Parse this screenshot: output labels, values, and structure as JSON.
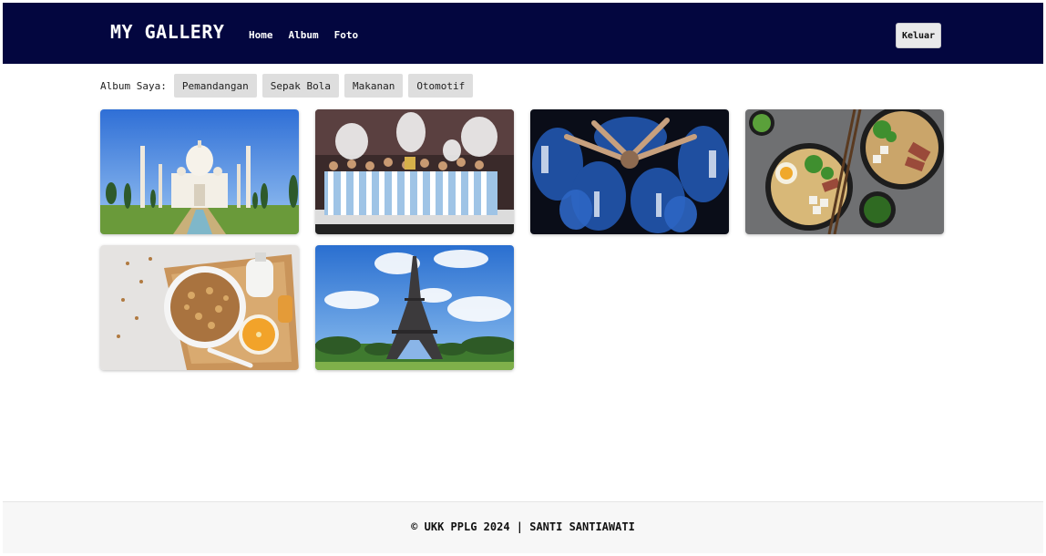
{
  "header": {
    "brand": "MY GALLERY",
    "nav": [
      "Home",
      "Album",
      "Foto"
    ],
    "logout_label": "Keluar"
  },
  "albums": {
    "label": "Album Saya:",
    "items": [
      "Pemandangan",
      "Sepak Bola",
      "Makanan",
      "Otomotif"
    ]
  },
  "footer": {
    "text": "© UKK PPLG 2024 | SANTI SANTIAWATI"
  },
  "colors": {
    "navbar": "#03063f",
    "button_bg": "#dedede"
  }
}
